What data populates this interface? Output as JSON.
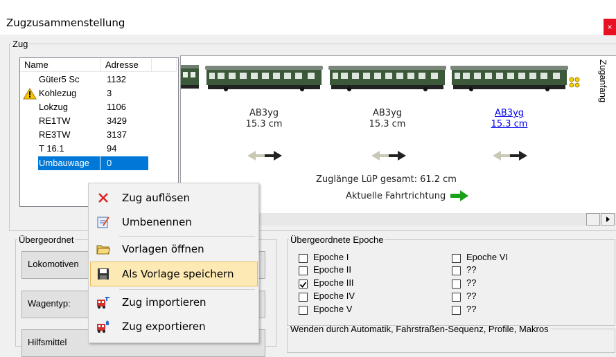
{
  "window": {
    "title": "Zugzusammenstellung",
    "close_label": "×"
  },
  "zug_group": {
    "legend": "Zug",
    "columns": [
      "Name",
      "Adresse"
    ],
    "rows": [
      {
        "name": "Güter5 Sc",
        "address": "1132",
        "warning": false
      },
      {
        "name": "Kohlezug",
        "address": "3",
        "warning": true
      },
      {
        "name": "Lokzug",
        "address": "1106",
        "warning": false
      },
      {
        "name": "RE1TW",
        "address": "3429",
        "warning": false
      },
      {
        "name": "RE3TW",
        "address": "3137",
        "warning": false
      },
      {
        "name": "T 16.1",
        "address": "94",
        "warning": false
      },
      {
        "name": "Umbauwage",
        "address": "0",
        "warning": false,
        "selected": true
      }
    ]
  },
  "train": {
    "cars": [
      {
        "type": "AB3yg",
        "length": "15.3 cm"
      },
      {
        "type": "AB3yg",
        "length": "15.3 cm"
      },
      {
        "type": "AB3yg",
        "length": "15.3 cm"
      }
    ],
    "total_length": "Zuglänge LüP gesamt: 61.2 cm",
    "direction_label": "Aktuelle Fahrtrichtung",
    "zuganfang": "Zuganfang"
  },
  "uebergeordnet_left": {
    "legend": "Übergeordnet",
    "buttons": [
      "Lokomotiven",
      "Wagentyp:",
      "Hilfsmittel"
    ]
  },
  "epoche": {
    "legend": "Übergeordnete Epoche",
    "left": [
      {
        "label": "Epoche I",
        "checked": false
      },
      {
        "label": "Epoche II",
        "checked": false
      },
      {
        "label": "Epoche III",
        "checked": true
      },
      {
        "label": "Epoche IV",
        "checked": false
      },
      {
        "label": "Epoche V",
        "checked": false
      }
    ],
    "right": [
      {
        "label": "Epoche VI",
        "checked": false
      },
      {
        "label": "??",
        "checked": false
      },
      {
        "label": "??",
        "checked": false
      },
      {
        "label": "??",
        "checked": false
      },
      {
        "label": "??",
        "checked": false
      }
    ]
  },
  "wenden_legend": "Wenden durch Automatik, Fahrstraßen-Sequenz, Profile, Makros",
  "context_menu": {
    "items": [
      {
        "label": "Zug auflösen",
        "icon": "delete-x-icon"
      },
      {
        "label": "Umbenennen",
        "icon": "rename-icon"
      },
      {
        "label": "Vorlagen öffnen",
        "icon": "folder-open-icon"
      },
      {
        "label": "Als Vorlage speichern",
        "icon": "save-icon",
        "highlighted": true
      },
      {
        "label": "Zug importieren",
        "icon": "import-train-icon"
      },
      {
        "label": "Zug exportieren",
        "icon": "export-train-icon"
      }
    ]
  },
  "colors": {
    "selection": "#0078d7",
    "menu_highlight": "#fde9b3",
    "close": "#e81123",
    "wagon": "#3c5a3a"
  }
}
